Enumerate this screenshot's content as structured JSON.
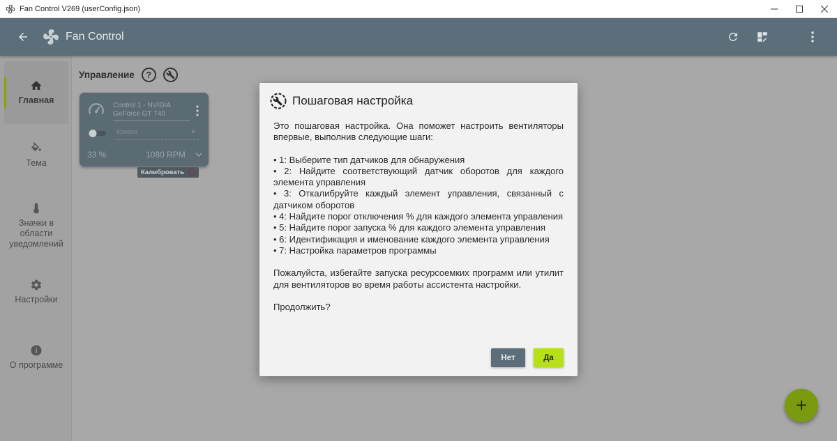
{
  "window": {
    "title": "Fan Control V269 (userConfig.json)",
    "controls": [
      "minimize",
      "maximize",
      "close"
    ]
  },
  "header": {
    "app_name": "Fan Control",
    "icons": [
      "back-arrow-icon",
      "fan-logo-icon",
      "refresh-icon",
      "layout-edit-icon",
      "more-vert-icon"
    ]
  },
  "sidebar": {
    "items": [
      {
        "label": "Главная",
        "icon": "home-icon",
        "active": true
      },
      {
        "label": "Тема",
        "icon": "paint-bucket-icon"
      },
      {
        "label": "Значки в области уведомлений",
        "icon": "thermometer-icon"
      },
      {
        "label": "Настройки",
        "icon": "gear-icon"
      },
      {
        "label": "О программе",
        "icon": "info-icon"
      }
    ]
  },
  "main": {
    "section_title": "Управление",
    "help_glyph": "?",
    "control_card": {
      "name": "Control 1 - NVIDIA GeForce GT 740",
      "curve_placeholder": "Кривая",
      "percent": "33 %",
      "rpm": "1080 RPM",
      "calibrate_label": "Калибровать"
    },
    "fab_label": "+"
  },
  "dialog": {
    "title": "Пошаговая настройка",
    "intro": "Это пошаговая настройка. Она поможет настроить вентиляторы впервые, выполнив следующие шаги:",
    "steps": [
      "• 1: Выберите тип датчиков для обнаружения",
      "• 2: Найдите соответствующий датчик оборотов для каждого элемента управления",
      "• 3: Откалибруйте каждый элемент управления, связанный с датчиком оборотов",
      "• 4: Найдите порог отключения % для каждого элемента управления",
      "• 5: Найдите порог запуска % для каждого элемента управления",
      "• 6: Идентификация и именование каждого элемента управления",
      "• 7: Настройка параметров программы"
    ],
    "warning": "Пожалуйста, избегайте запуска ресурсоемких программ или утилит для вентиляторов во время работы ассистента настройки.",
    "question": "Продолжить?",
    "button_no": "Нет",
    "button_yes": "Да"
  },
  "colors": {
    "appbar": "#5b6e79",
    "accent": "#b8e016",
    "card": "#5b6b73",
    "overlay": "#a8a8a8"
  }
}
